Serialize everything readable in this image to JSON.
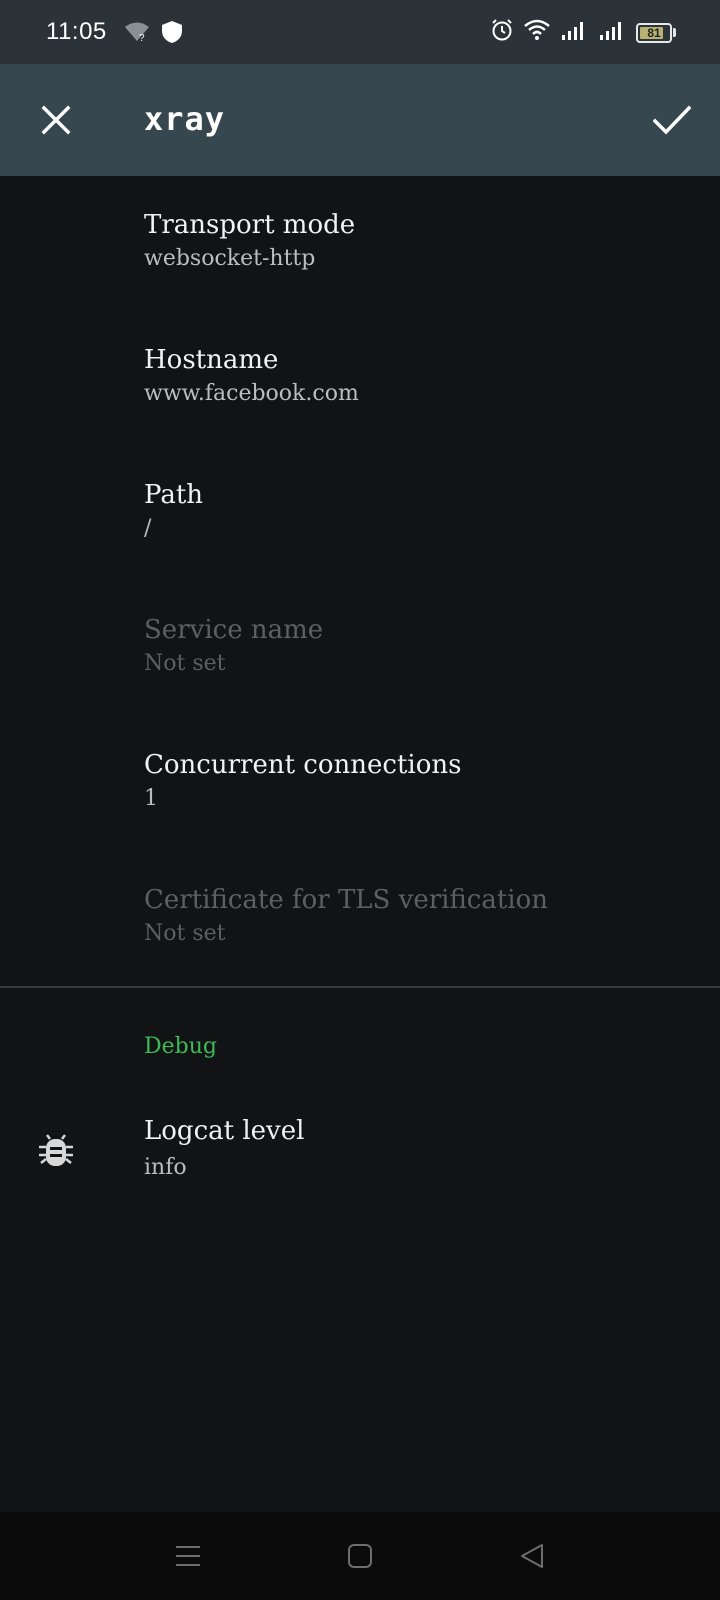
{
  "status_bar": {
    "time": "11:05",
    "battery_level": "81",
    "left_icons": [
      "wifi-question-icon",
      "shield-icon"
    ],
    "right_icons": [
      "alarm-icon",
      "wifi-icon",
      "signal-icon",
      "signal-icon",
      "battery-icon"
    ]
  },
  "app_bar": {
    "title": "xray",
    "close_icon": "close-icon",
    "confirm_icon": "check-icon"
  },
  "preferences": [
    {
      "title": "Transport mode",
      "summary": "websocket-http",
      "enabled": true
    },
    {
      "title": "Hostname",
      "summary": "www.facebook.com",
      "enabled": true
    },
    {
      "title": "Path",
      "summary": "/",
      "enabled": true
    },
    {
      "title": "Service name",
      "summary": "Not set",
      "enabled": false
    },
    {
      "title": "Concurrent connections",
      "summary": "1",
      "enabled": true
    },
    {
      "title": "Certificate for TLS verification",
      "summary": "Not set",
      "enabled": false
    }
  ],
  "debug": {
    "category_title": "Debug",
    "logcat": {
      "title": "Logcat level",
      "summary": "info",
      "icon": "bug-icon"
    }
  },
  "nav_bar": {
    "buttons": [
      "menu-icon",
      "home-icon",
      "back-icon"
    ]
  },
  "colors": {
    "status_bar_bg": "#2c3338",
    "app_bar_bg": "#37474f",
    "background": "#121314",
    "accent": "#3fba58",
    "disabled_text": "#5d5f61"
  }
}
